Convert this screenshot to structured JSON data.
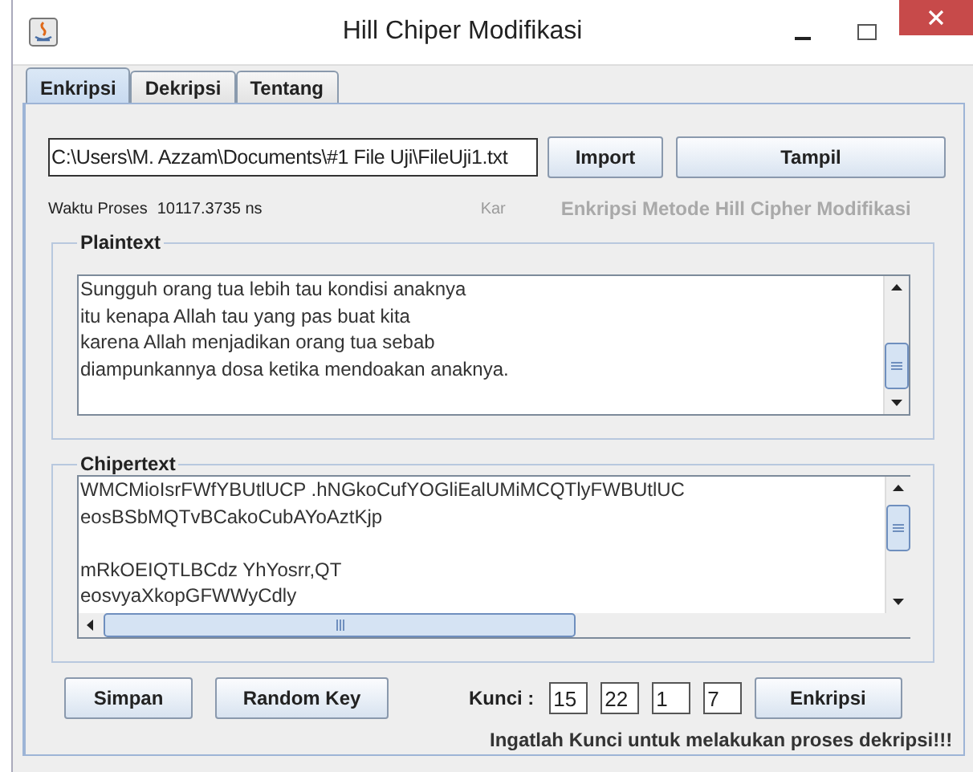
{
  "window": {
    "title": "Hill Chiper Modifikasi"
  },
  "tabs": [
    {
      "label": "Enkripsi",
      "selected": true
    },
    {
      "label": "Dekripsi",
      "selected": false
    },
    {
      "label": "Tentang",
      "selected": false
    }
  ],
  "file_path": {
    "value": "C:\\Users\\M. Azzam\\Documents\\#1 File Uji\\FileUji1.txt"
  },
  "import_button": "Import",
  "show_button": "Tampil",
  "process_time": {
    "label": "Waktu Proses",
    "value": "10117.3735 ns"
  },
  "char_label": "Kar",
  "method_label": "Enkripsi Metode Hill Cipher Modifikasi",
  "plaintext": {
    "title": "Plaintext",
    "text": "Sungguh orang tua lebih tau kondisi anaknya\nitu kenapa Allah tau yang pas buat kita\nkarena Allah menjadikan orang tua sebab\ndiampunkannya dosa ketika mendoakan anaknya."
  },
  "ciphertext": {
    "title": "Chipertext",
    "text": "WMCMioIsrFWfYBUtlUCP .hNGkoCufYOGliEalUMiMCQTlyFWBUtlUC\neosBSbMQTvBCakoCubAYoAztKjp\n\nmRkOEIQTLBCdz YhYosrr,QT\neosvyaXkopGFWWyCdly"
  },
  "save_button": "Simpan",
  "random_key_button": "Random Key",
  "key": {
    "label": "Kunci :",
    "values": [
      "15",
      "22",
      "1",
      "7"
    ]
  },
  "encrypt_button": "Enkripsi",
  "reminder": "Ingatlah Kunci untuk melakukan proses dekripsi!!!"
}
